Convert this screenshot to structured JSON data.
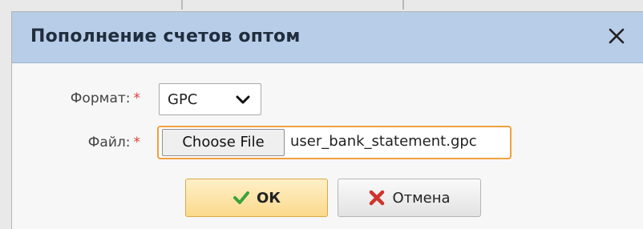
{
  "dialog": {
    "title": "Пополнение счетов оптом",
    "close_icon": "close-icon"
  },
  "form": {
    "format_label": "Формат:",
    "required_marker": "*",
    "format_value": "GPC",
    "file_label": "Файл:",
    "choose_file_label": "Choose File",
    "file_name": "user_bank_statement.gpc"
  },
  "actions": {
    "ok_label": "ОК",
    "cancel_label": "Отмена",
    "ok_icon": "checkmark-icon",
    "cancel_icon": "x-icon"
  },
  "colors": {
    "titlebar": "#b8cde8",
    "required": "#e23b3b",
    "file_focus_border": "#f0a13c",
    "ok_check": "#3aa33a",
    "cancel_x": "#d0342c"
  }
}
